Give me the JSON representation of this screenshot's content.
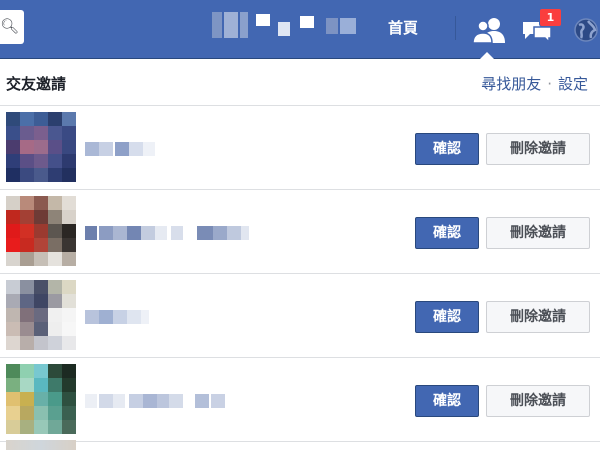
{
  "topbar": {
    "nav_home_label": "首頁",
    "notification_badge_count": "1",
    "colors": {
      "bar": "#4267b2",
      "badge": "#fa3e3e"
    }
  },
  "friend_requests_panel": {
    "title": "交友邀請",
    "links": {
      "find_friends": "尋找朋友",
      "separator": "·",
      "settings": "設定"
    },
    "requests": [
      {
        "confirm_label": "確認",
        "delete_label": "刪除邀請"
      },
      {
        "confirm_label": "確認",
        "delete_label": "刪除邀請"
      },
      {
        "confirm_label": "確認",
        "delete_label": "刪除邀請"
      },
      {
        "confirm_label": "確認",
        "delete_label": "刪除邀請"
      }
    ],
    "colors": {
      "confirm": "#4267b2",
      "delete": "#f6f7f9",
      "link": "#365899"
    }
  },
  "icons": [
    "search-icon",
    "friend-requests-icon",
    "messages-icon",
    "notifications-globe-icon"
  ]
}
